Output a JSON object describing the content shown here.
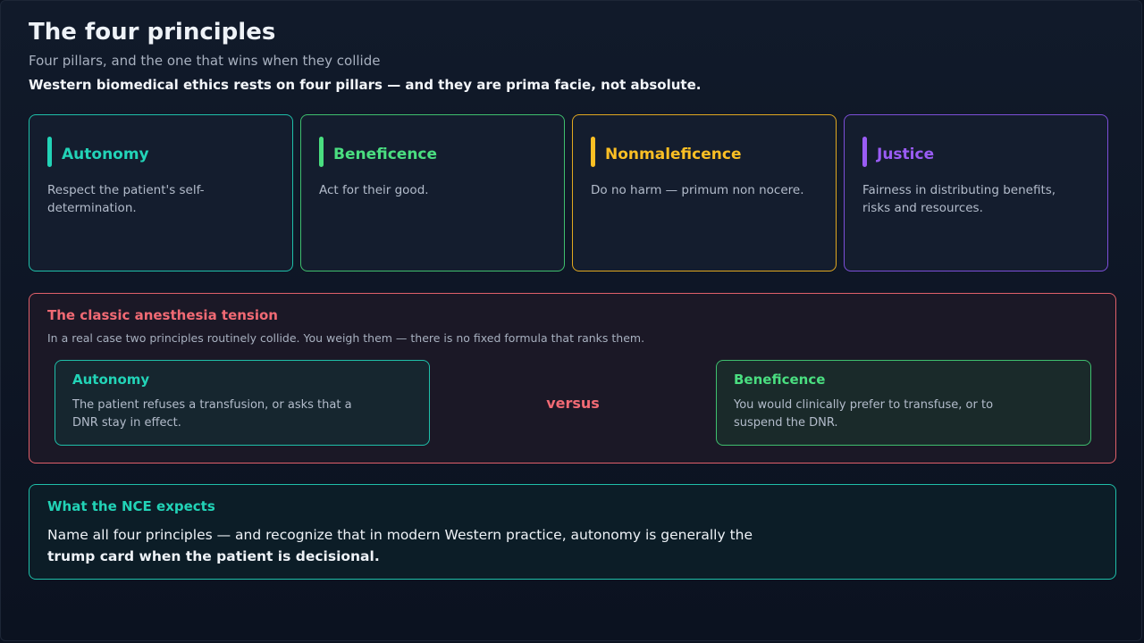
{
  "header": {
    "title": "The four principles",
    "subtitle": "Four pillars, and the one that wins when they collide",
    "lead": "Western biomedical ethics rests on four pillars — and they are prima facie, not absolute."
  },
  "principles": [
    {
      "name": "Autonomy",
      "description": "Respect the patient's self-determination.",
      "color": "#22d3b7"
    },
    {
      "name": "Beneficence",
      "description": "Act for their good.",
      "color": "#4ade80"
    },
    {
      "name": "Nonmaleficence",
      "description": "Do no harm — primum non nocere.",
      "color": "#fbbf24"
    },
    {
      "name": "Justice",
      "description": "Fairness in distributing benefits, risks and resources.",
      "color": "#9a5cf5"
    }
  ],
  "tension": {
    "heading": "The classic anesthesia tension",
    "subtext": "In a real case two principles routinely collide. You weigh them — there is no fixed formula that ranks them.",
    "left": {
      "name": "Autonomy",
      "description": "The patient refuses a transfusion, or asks that a DNR stay in effect."
    },
    "versus": "versus",
    "right": {
      "name": "Beneficence",
      "description": "You would clinically prefer to transfuse, or to suspend the DNR."
    },
    "color": "#f16a74"
  },
  "nce": {
    "heading": "What the NCE expects",
    "body_plain": "Name all four principles — and recognize that in modern Western practice, autonomy is generally the",
    "body_bold": "trump card when the patient is decisional."
  }
}
